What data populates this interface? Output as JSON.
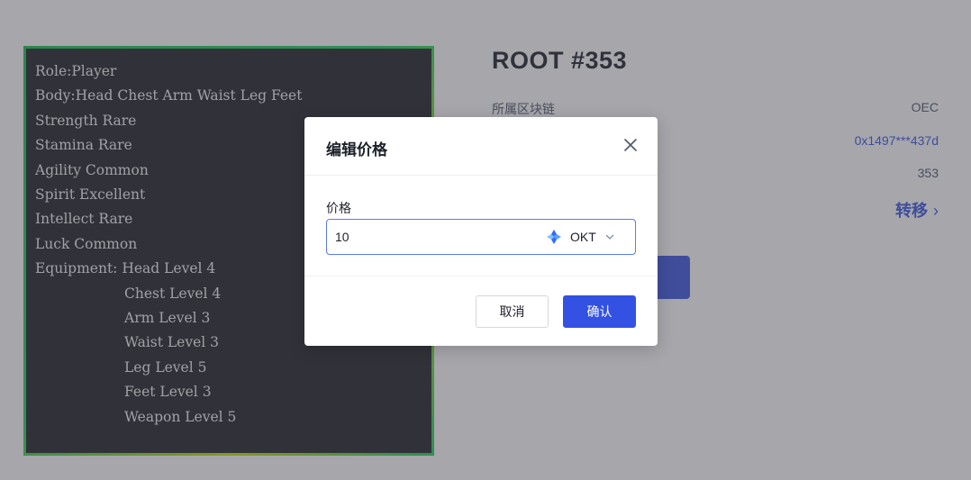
{
  "nft": {
    "attributes": [
      "Role:Player",
      "Body:Head Chest Arm Waist Leg Feet",
      "Strength Rare",
      "Stamina Rare",
      "Agility Common",
      "Spirit Excellent",
      "Intellect Rare",
      "Luck Common",
      "Equipment: Head Level 4"
    ],
    "equipment_rest": [
      "Chest Level 4",
      "Arm Level 3",
      "Waist Level 3",
      "Leg Level 5",
      "Feet Level 3",
      "Weapon Level 5"
    ]
  },
  "detail": {
    "title": "ROOT #353",
    "rows": [
      {
        "label": "所属区块链",
        "value": "OEC"
      },
      {
        "label": "",
        "value": "0x1497***437d"
      },
      {
        "label": "",
        "value": "353"
      }
    ],
    "transfer_label": "转移"
  },
  "modal": {
    "title": "编辑价格",
    "price_label": "价格",
    "price_value": "10",
    "token": "OKT",
    "cancel_label": "取消",
    "confirm_label": "确认"
  },
  "colors": {
    "accent": "#3351e3",
    "link": "#3a55e0",
    "card_border": "#1bd35a",
    "card_bg": "#202225"
  }
}
